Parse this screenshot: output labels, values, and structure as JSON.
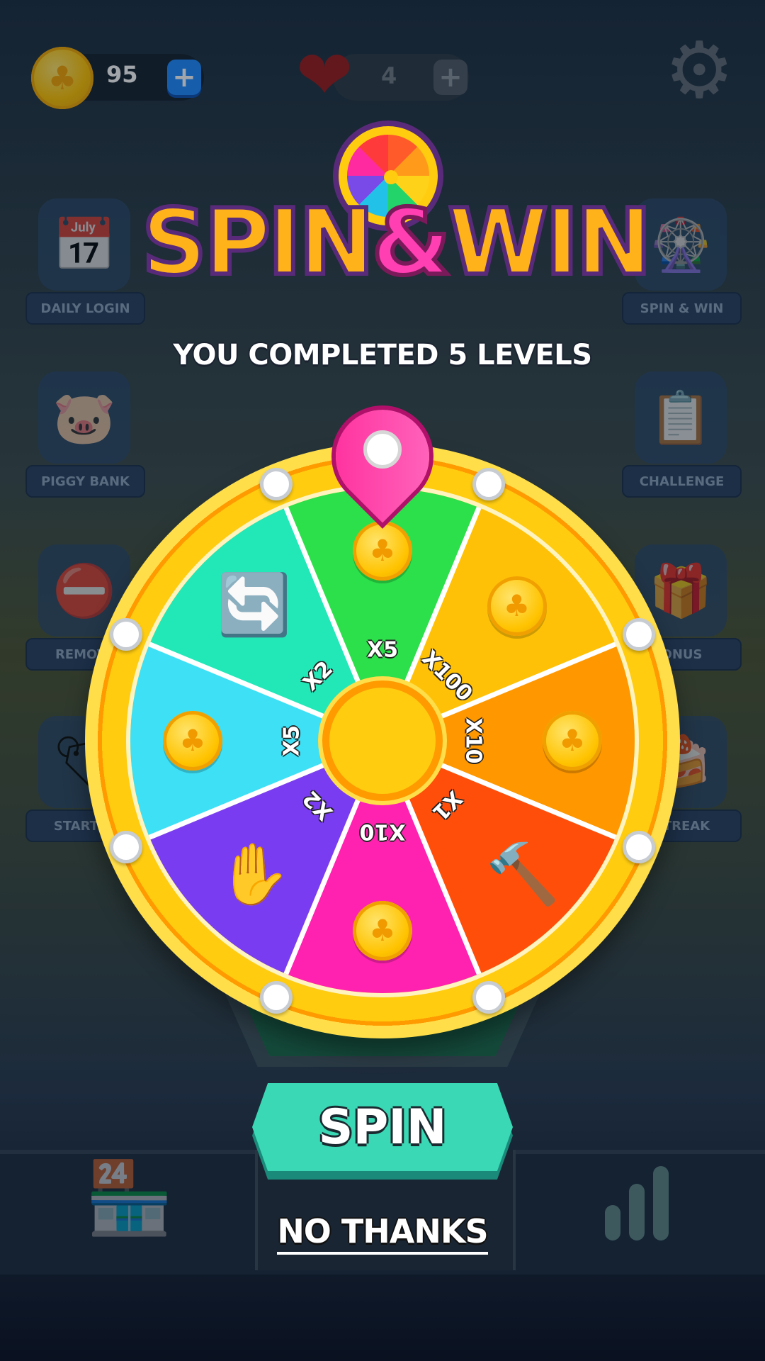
{
  "topbar": {
    "coins": "95",
    "lives": "4",
    "plus_symbol": "+",
    "gear_glyph": "⚙",
    "heart_glyph": "❤",
    "clover_glyph": "♣"
  },
  "side_menu": {
    "left": [
      {
        "label": "DAILY LOGIN",
        "icon": "calendar-icon",
        "glyph": "📅"
      },
      {
        "label": "PIGGY BANK",
        "icon": "piggy-bank-icon",
        "glyph": "🐷"
      },
      {
        "label": "REMOVE",
        "icon": "remove-ads-icon",
        "glyph": "⛔"
      },
      {
        "label": "STARTER",
        "icon": "starter-pack-icon",
        "glyph": "🏷"
      }
    ],
    "right": [
      {
        "label": "SPIN & WIN",
        "icon": "spin-wheel-icon",
        "glyph": "🎡"
      },
      {
        "label": "CHALLENGE",
        "icon": "clipboard-icon",
        "glyph": "📋"
      },
      {
        "label": "ONUS",
        "icon": "gift-icon",
        "glyph": "🎁"
      },
      {
        "label": "STREAK",
        "icon": "streak-icon",
        "glyph": "🍰"
      }
    ]
  },
  "title": {
    "part1": "SPIN",
    "amp": "&",
    "part2": "WIN"
  },
  "subtitle": "YOU COMPLETED 5 LEVELS",
  "wheel": {
    "segments": [
      {
        "label": "X5",
        "reward": "coin",
        "color": "#2be04a"
      },
      {
        "label": "X100",
        "reward": "coin",
        "color": "#ffc107"
      },
      {
        "label": "X10",
        "reward": "coin",
        "color": "#ff9800"
      },
      {
        "label": "X1",
        "reward": "hammer",
        "color": "#ff4e0a"
      },
      {
        "label": "X10",
        "reward": "coin",
        "color": "#ff22b0"
      },
      {
        "label": "X2",
        "reward": "hand",
        "color": "#7a3cf0"
      },
      {
        "label": "X5",
        "reward": "coin",
        "color": "#3ee0f5"
      },
      {
        "label": "X2",
        "reward": "refresh",
        "color": "#22e8b8"
      }
    ],
    "reward_glyphs": {
      "hammer": "🔨",
      "hand": "✋",
      "refresh": "🔄"
    }
  },
  "buttons": {
    "spin": "SPIN",
    "no_thanks": "NO THANKS"
  },
  "colors": {
    "accent_teal": "#3ad8b4",
    "title_orange": "#ffb21a",
    "title_pink": "#ff3fb2",
    "coin_gold": "#ffc300"
  }
}
